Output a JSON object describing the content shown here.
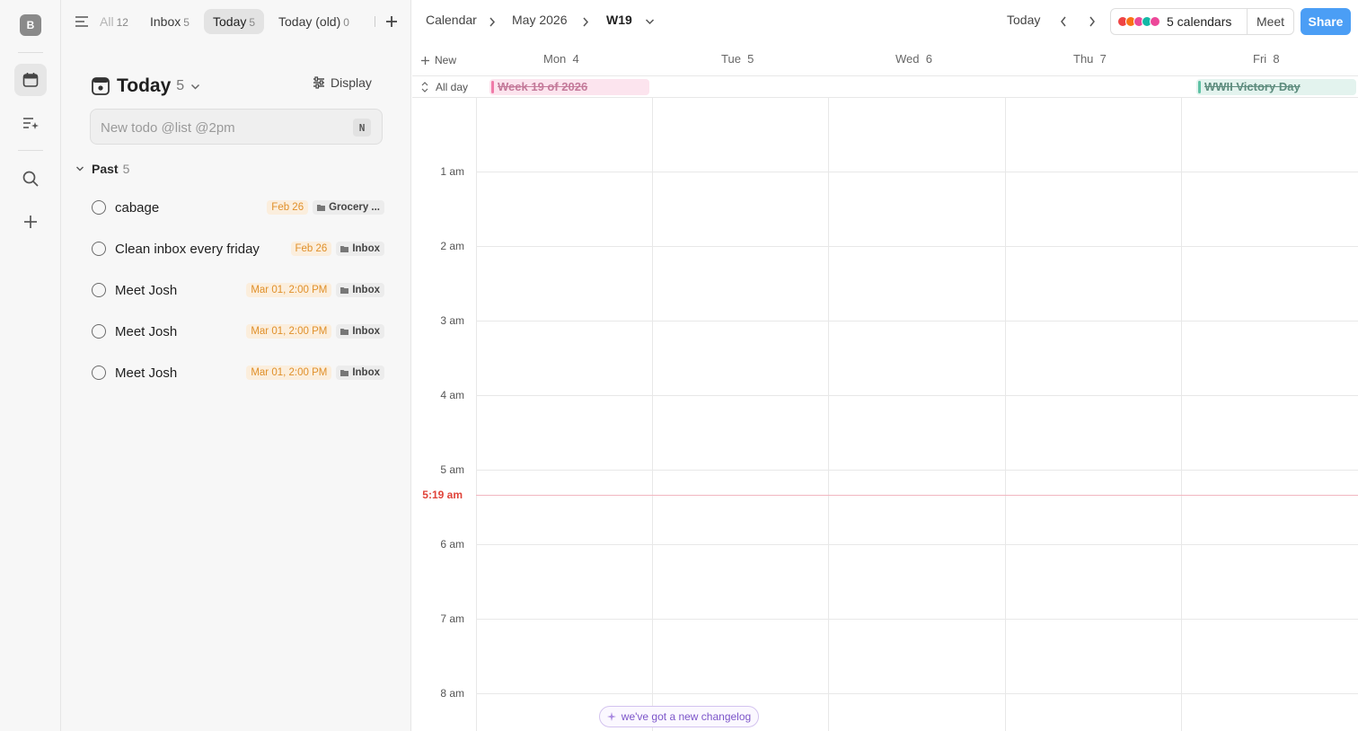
{
  "rail": {
    "avatar_letter": "B"
  },
  "tabs": [
    {
      "label": "All",
      "count": "12"
    },
    {
      "label": "Inbox",
      "count": "5"
    },
    {
      "label": "Today",
      "count": "5"
    },
    {
      "label": "Today (old)",
      "count": "0"
    }
  ],
  "list": {
    "title": "Today",
    "count": "5",
    "display_label": "Display",
    "new_todo_placeholder": "New todo @list @2pm",
    "new_todo_shortcut": "N",
    "section": {
      "label": "Past",
      "count": "5"
    },
    "todos": [
      {
        "title": "cabage",
        "date": "Feb 26",
        "list": "Grocery ..."
      },
      {
        "title": "Clean inbox every friday",
        "date": "Feb 26",
        "list": "Inbox"
      },
      {
        "title": "Meet Josh",
        "date": "Mar 01, 2:00 PM",
        "list": "Inbox"
      },
      {
        "title": "Meet Josh",
        "date": "Mar 01, 2:00 PM",
        "list": "Inbox"
      },
      {
        "title": "Meet Josh",
        "date": "Mar 01, 2:00 PM",
        "list": "Inbox"
      }
    ]
  },
  "calendar": {
    "breadcrumb": [
      "Calendar",
      "May 2026",
      "W19"
    ],
    "today_label": "Today",
    "calendars_label": "5 calendars",
    "calendar_colors": [
      "#ef4444",
      "#f97316",
      "#ec4899",
      "#14b8a6",
      "#ec4899"
    ],
    "meet_label": "Meet",
    "share_label": "Share",
    "new_label": "New",
    "allday_label": "All day",
    "days": [
      {
        "name": "Mon",
        "num": "4"
      },
      {
        "name": "Tue",
        "num": "5"
      },
      {
        "name": "Wed",
        "num": "6"
      },
      {
        "name": "Thu",
        "num": "7"
      },
      {
        "name": "Fri",
        "num": "8"
      }
    ],
    "allday_events": [
      {
        "title": "Week 19 of 2026",
        "day": "Mon",
        "color": "#f07aa8"
      },
      {
        "title": "WWII Victory Day",
        "day": "Fri",
        "color": "#5fc2a5"
      }
    ],
    "hours": [
      "1 am",
      "2 am",
      "3 am",
      "4 am",
      "5 am",
      "6 am",
      "7 am",
      "8 am"
    ],
    "now_label": "5:19 am",
    "changelog_label": "we've got a new changelog"
  }
}
